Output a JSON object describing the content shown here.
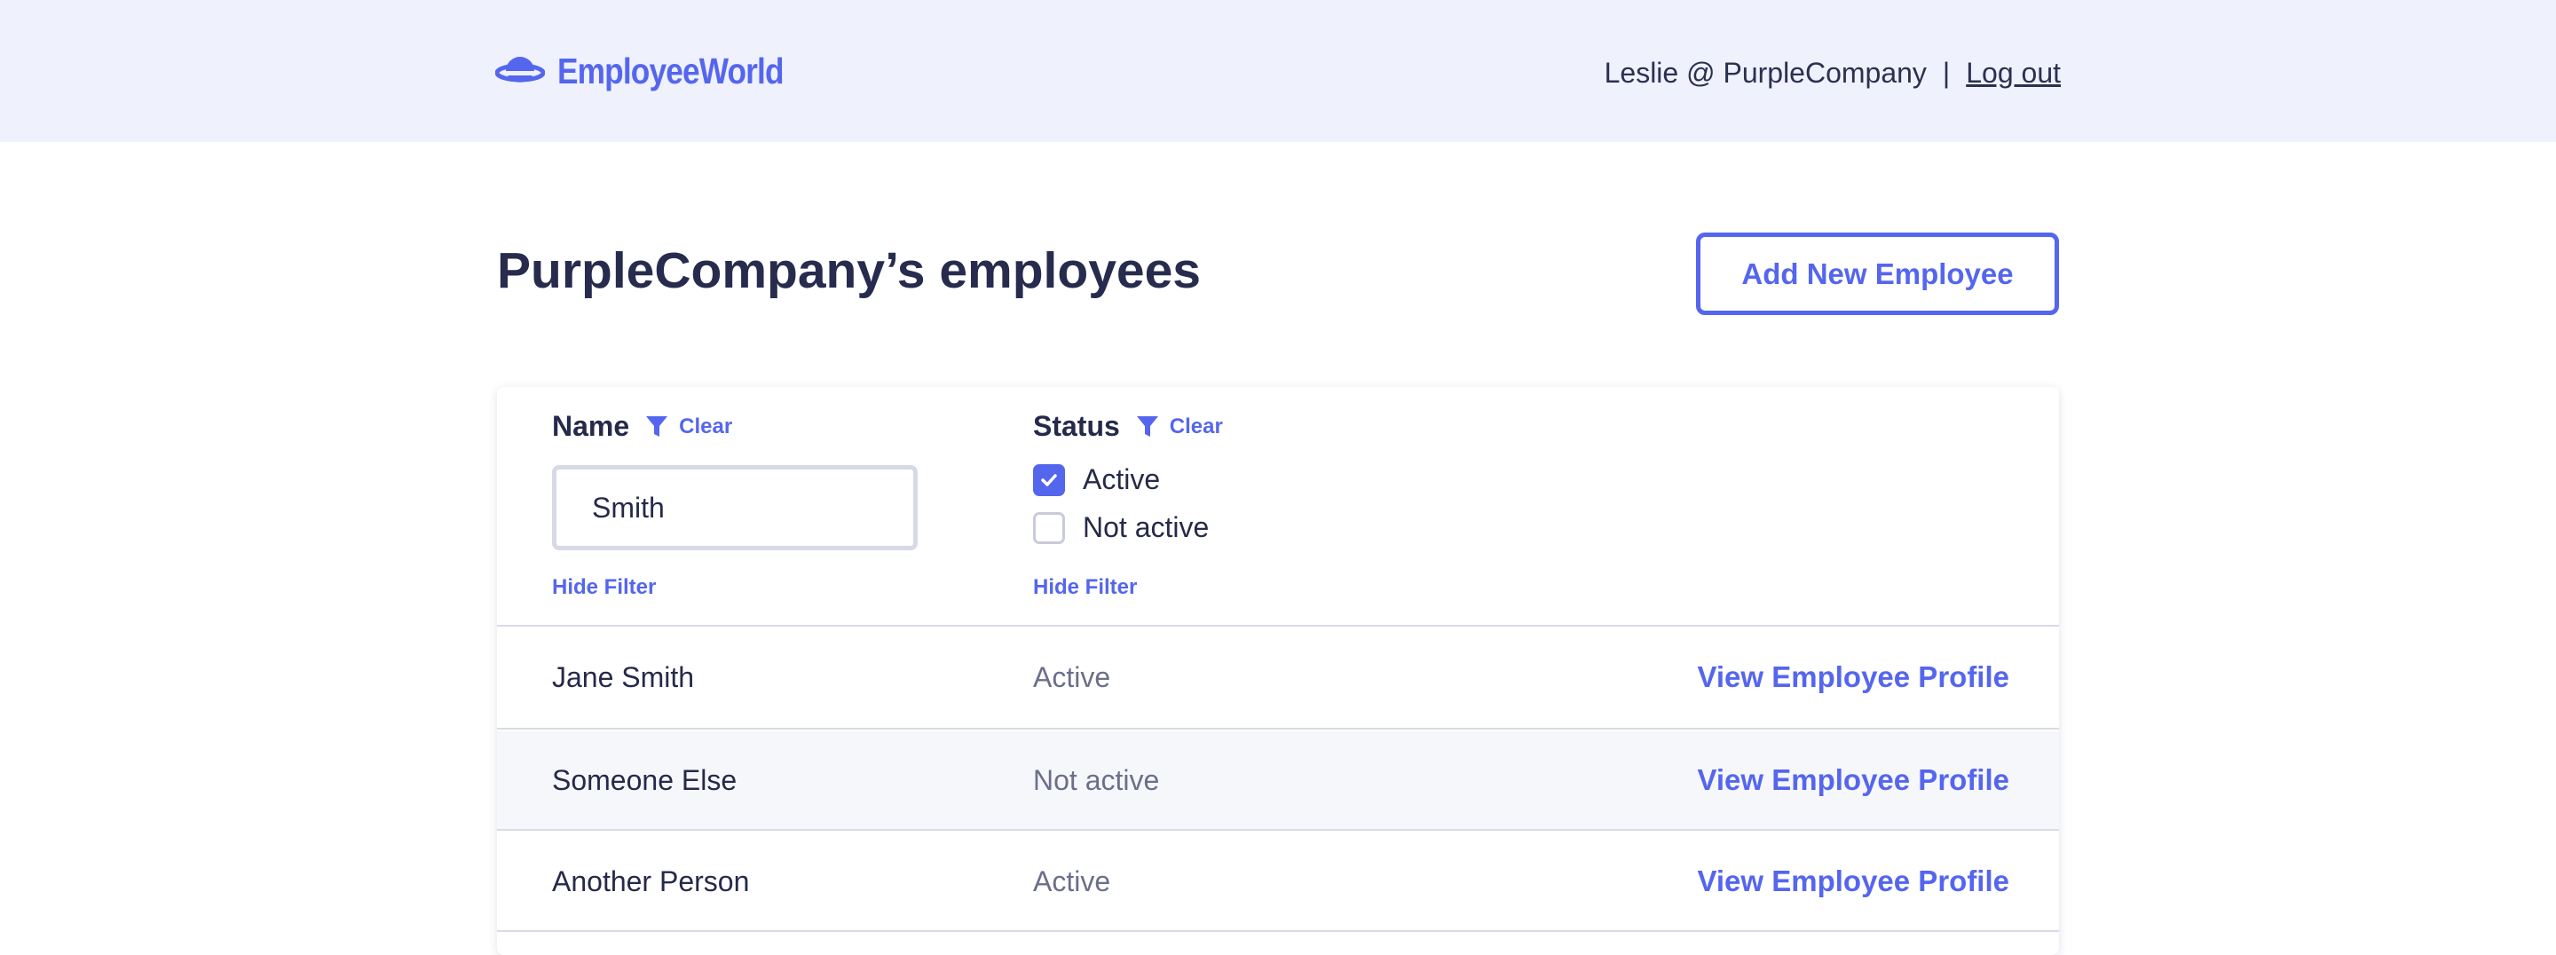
{
  "header": {
    "brand_name": "EmployeeWorld",
    "user_label": "Leslie @ PurpleCompany",
    "separator": "|",
    "logout_label": "Log out"
  },
  "main": {
    "title": "PurpleCompany’s employees",
    "add_button_label": "Add New Employee"
  },
  "filters": {
    "name": {
      "label": "Name",
      "clear_label": "Clear",
      "input_value": "Smith",
      "hide_label": "Hide Filter"
    },
    "status": {
      "label": "Status",
      "clear_label": "Clear",
      "options": [
        {
          "label": "Active",
          "checked": true
        },
        {
          "label": "Not active",
          "checked": false
        }
      ],
      "hide_label": "Hide Filter"
    }
  },
  "rows": [
    {
      "name": "Jane Smith",
      "status": "Active",
      "link": "View Employee Profile"
    },
    {
      "name": "Someone Else",
      "status": "Not active",
      "link": "View Employee Profile"
    },
    {
      "name": "Another Person",
      "status": "Active",
      "link": "View Employee Profile"
    }
  ],
  "colors": {
    "accent": "#5566ee",
    "header_bg": "#eff1fd",
    "text": "#252a4a"
  },
  "icons": {
    "logo": "planet-icon",
    "filter": "funnel-icon",
    "check": "checkmark-icon"
  }
}
